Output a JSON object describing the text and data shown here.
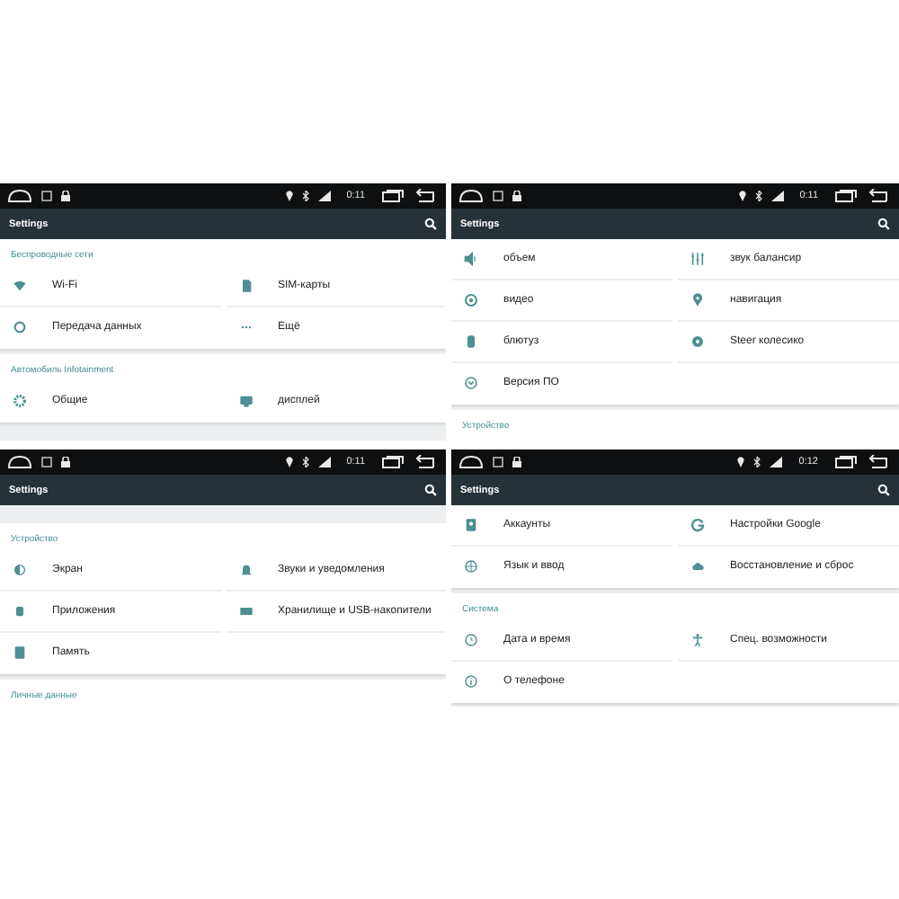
{
  "panels": [
    {
      "status": {
        "time": "0:11"
      },
      "title": "Settings",
      "blocks": [
        {
          "header": "Беспроводные сети",
          "rows": [
            [
              "Wi-Fi",
              "SIM-карты"
            ],
            [
              "Передача данных",
              "Ещё"
            ]
          ]
        },
        {
          "header": "Автомобиль Infotainment",
          "rows": [
            [
              "Общие",
              "дисплей"
            ]
          ]
        }
      ]
    },
    {
      "status": {
        "time": "0:11"
      },
      "title": "Settings",
      "blocks": [
        {
          "rows": [
            [
              "объем",
              "звук балансир"
            ],
            [
              "видео",
              "навигация"
            ],
            [
              "блютуз",
              "Steer колесико"
            ],
            [
              "Версия ПО"
            ]
          ]
        },
        {
          "header": "Устройство"
        }
      ]
    },
    {
      "status": {
        "time": "0:11"
      },
      "title": "Settings",
      "blocks": [
        {
          "header": "Устройство",
          "rows": [
            [
              "Экран",
              "Звуки и уведомления"
            ],
            [
              "Приложения",
              "Хранилище и USB-накопители"
            ],
            [
              "Память"
            ]
          ]
        },
        {
          "header": "Личные данные"
        }
      ]
    },
    {
      "status": {
        "time": "0:12"
      },
      "title": "Settings",
      "blocks": [
        {
          "rows": [
            [
              "Аккаунты",
              "Настройки Google"
            ],
            [
              "Язык и ввод",
              "Восстановление и сброс"
            ]
          ]
        },
        {
          "header": "Система",
          "rows": [
            [
              "Дата и время",
              "Спец. возможности"
            ],
            [
              "О телефоне"
            ]
          ]
        }
      ]
    }
  ]
}
